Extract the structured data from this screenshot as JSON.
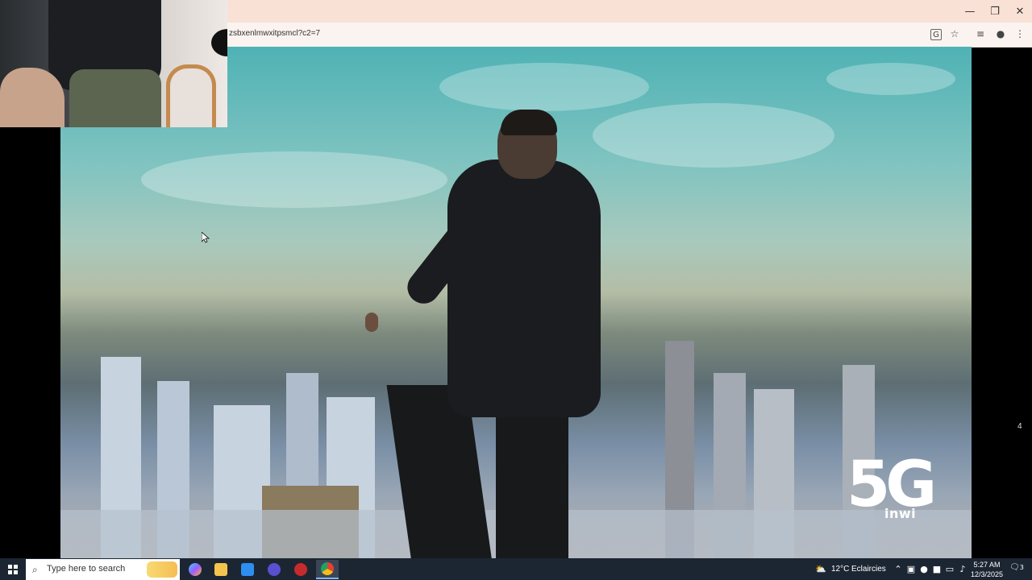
{
  "browser": {
    "url_fragment": "zsbxenlmwxitpsmcl?c2=7",
    "window_controls": {
      "minimize": "—",
      "maximize": "❐",
      "close": "✕"
    },
    "toolbar_icons": [
      "translate-icon",
      "star-icon",
      "reading-list-icon",
      "profile-icon",
      "menu-icon"
    ],
    "colors": {
      "titlebar": "#f9e1d6",
      "addressbar": "#fbf3ef"
    }
  },
  "video": {
    "logo_text": "5G",
    "logo_brand": "inwi",
    "side_counter": "4"
  },
  "taskbar": {
    "search_placeholder": "Type here to search",
    "weather": {
      "temp": "12°C",
      "condition": "Eclaircies"
    },
    "clock": {
      "time": "5:27 AM",
      "date": "12/3/2025"
    },
    "notification_count": "3",
    "pinned_apps": [
      "copilot",
      "file-explorer",
      "store",
      "edge-dev",
      "game-app",
      "chrome"
    ]
  }
}
